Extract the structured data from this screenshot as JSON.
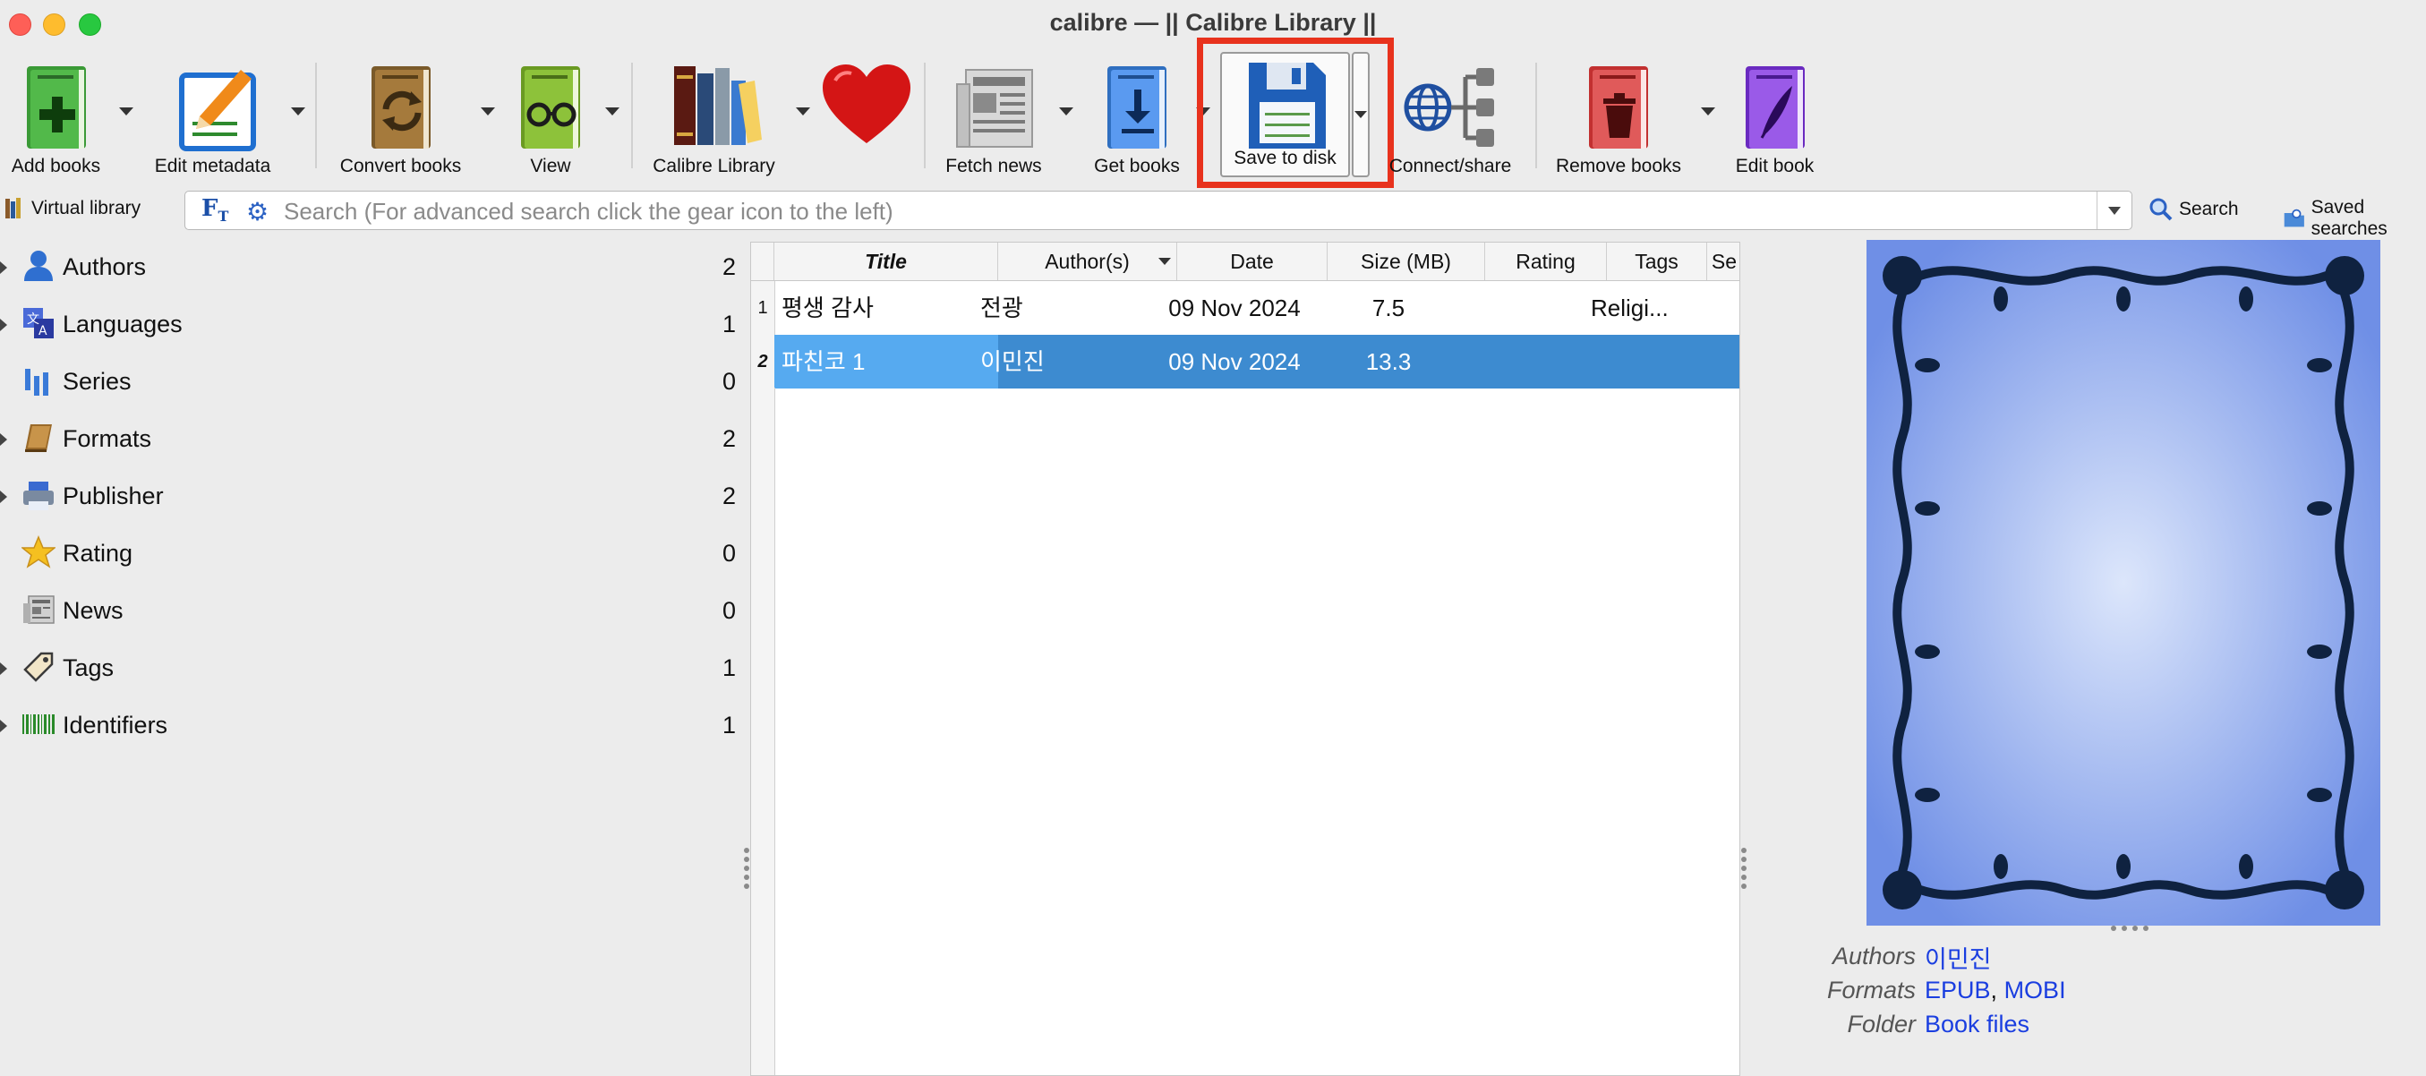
{
  "window": {
    "title": "calibre — || Calibre Library ||"
  },
  "toolbar": {
    "add_books": "Add books",
    "edit_metadata": "Edit metadata",
    "convert_books": "Convert books",
    "view": "View",
    "calibre_library": "Calibre Library",
    "fetch_news": "Fetch news",
    "get_books": "Get books",
    "save_to_disk": "Save to disk",
    "connect_share": "Connect/share",
    "remove_books": "Remove books",
    "edit_book": "Edit book"
  },
  "search": {
    "virtual_library": "Virtual library",
    "placeholder": "Search (For advanced search click the gear icon to the left)",
    "search_button": "Search",
    "saved_searches": "Saved searches"
  },
  "tag_browser": {
    "items": [
      {
        "label": "Authors",
        "count": "2"
      },
      {
        "label": "Languages",
        "count": "1"
      },
      {
        "label": "Series",
        "count": "0"
      },
      {
        "label": "Formats",
        "count": "2"
      },
      {
        "label": "Publisher",
        "count": "2"
      },
      {
        "label": "Rating",
        "count": "0"
      },
      {
        "label": "News",
        "count": "0"
      },
      {
        "label": "Tags",
        "count": "1"
      },
      {
        "label": "Identifiers",
        "count": "1"
      }
    ]
  },
  "book_list": {
    "columns": [
      "Title",
      "Author(s)",
      "Date",
      "Size (MB)",
      "Rating",
      "Tags",
      "Se"
    ],
    "rows": [
      {
        "num": "1",
        "title": "평생 감사",
        "author": "전광",
        "date": "09 Nov 2024",
        "size": "7.5",
        "rating": "",
        "tags": "Religi..."
      },
      {
        "num": "2",
        "title": "파친코 1",
        "author": "이민진",
        "date": "09 Nov 2024",
        "size": "13.3",
        "rating": "",
        "tags": ""
      }
    ]
  },
  "details": {
    "authors_label": "Authors",
    "authors_value": "이민진",
    "formats_label": "Formats",
    "format_epub": "EPUB",
    "format_sep": ",",
    "format_mobi": "MOBI",
    "folder_label": "Folder",
    "folder_value": "Book files"
  },
  "colors": {
    "highlight": "#e8321d",
    "selection": "#3d8bd0",
    "link": "#1a3ee0"
  }
}
